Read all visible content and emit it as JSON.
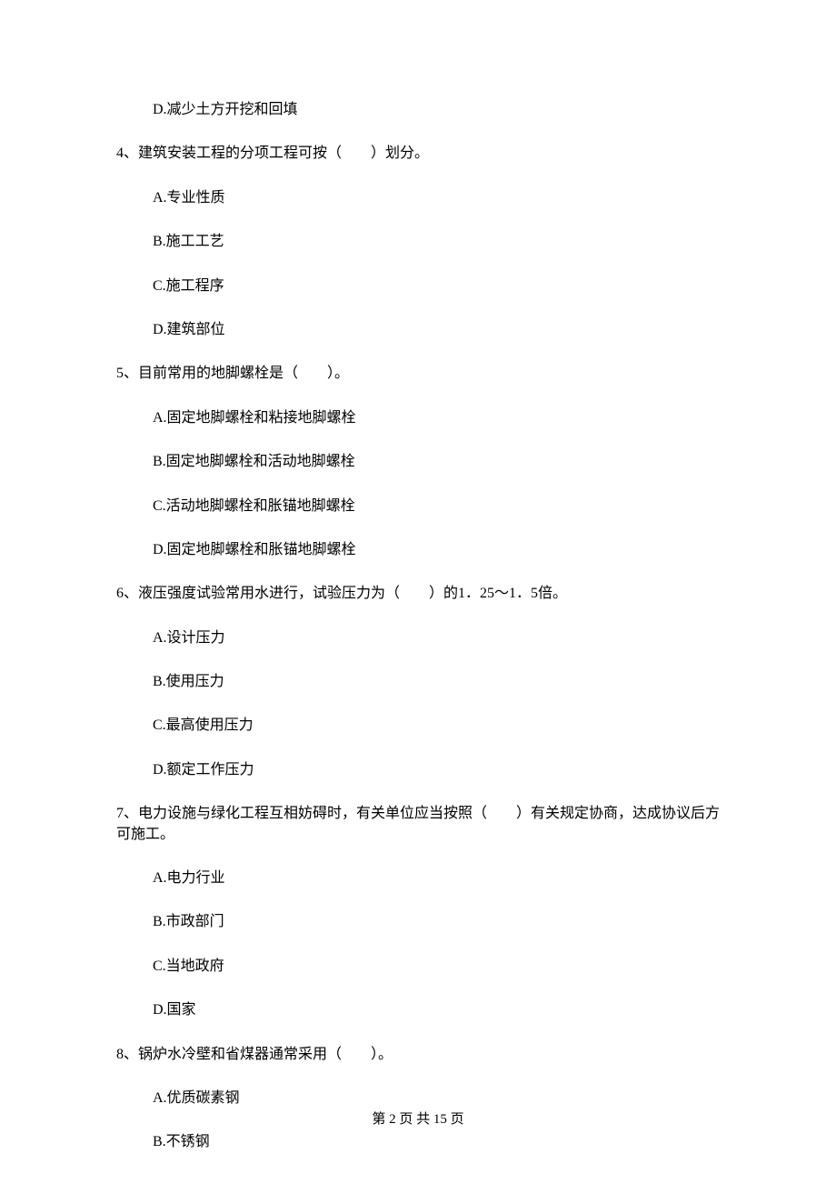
{
  "questions": [
    {
      "stem": "",
      "options": [
        "D.减少土方开挖和回填"
      ]
    },
    {
      "stem": "4、建筑安装工程的分项工程可按（　　）划分。",
      "options": [
        "A.专业性质",
        "B.施工工艺",
        "C.施工程序",
        "D.建筑部位"
      ]
    },
    {
      "stem": "5、目前常用的地脚螺栓是（　　）。",
      "options": [
        "A.固定地脚螺栓和粘接地脚螺栓",
        "B.固定地脚螺栓和活动地脚螺栓",
        "C.活动地脚螺栓和胀锚地脚螺栓",
        "D.固定地脚螺栓和胀锚地脚螺栓"
      ]
    },
    {
      "stem": "6、液压强度试验常用水进行，试验压力为（　　）的1．25～1．5倍。",
      "options": [
        "A.设计压力",
        "B.使用压力",
        "C.最高使用压力",
        "D.额定工作压力"
      ]
    },
    {
      "stem": "7、电力设施与绿化工程互相妨碍时，有关单位应当按照（　　）有关规定协商，达成协议后方可施工。",
      "options": [
        "A.电力行业",
        "B.市政部门",
        "C.当地政府",
        "D.国家"
      ]
    },
    {
      "stem": "8、锅炉水冷壁和省煤器通常采用（　　）。",
      "options": [
        "A.优质碳素钢",
        "B.不锈钢"
      ]
    }
  ],
  "footer": "第 2 页 共 15 页"
}
